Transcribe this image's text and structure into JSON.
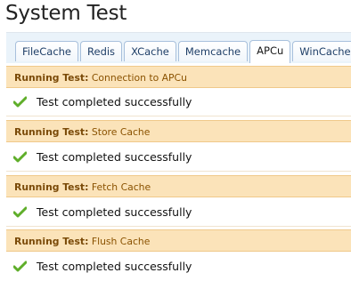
{
  "page": {
    "title": "System Test"
  },
  "tabs": [
    {
      "label": "FileCache",
      "active": false
    },
    {
      "label": "Redis",
      "active": false
    },
    {
      "label": "XCache",
      "active": false
    },
    {
      "label": "Memcache",
      "active": false
    },
    {
      "label": "APCu",
      "active": true
    },
    {
      "label": "WinCache",
      "active": false
    }
  ],
  "tests": [
    {
      "label": "Running Test:",
      "name": "Connection to APCu",
      "result": "Test completed successfully",
      "icon": "check-icon"
    },
    {
      "label": "Running Test:",
      "name": "Store Cache",
      "result": "Test completed successfully",
      "icon": "check-icon"
    },
    {
      "label": "Running Test:",
      "name": "Fetch Cache",
      "result": "Test completed successfully",
      "icon": "check-icon"
    },
    {
      "label": "Running Test:",
      "name": "Flush Cache",
      "result": "Test completed successfully",
      "icon": "check-icon"
    }
  ],
  "colors": {
    "header_bg": "#fbe3b9",
    "header_text": "#7a4a08",
    "tab_bar_bg": "#eaf3fa",
    "check_green": "#5fae2a"
  }
}
